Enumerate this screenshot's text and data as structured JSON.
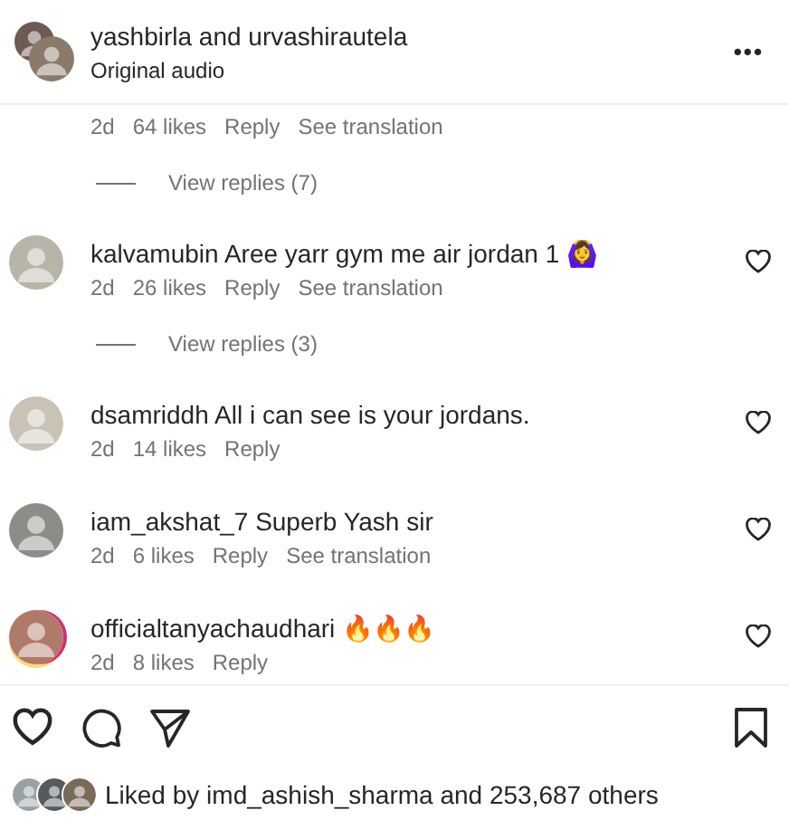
{
  "post": {
    "authors": "yashbirla and urvashirautela",
    "audio": "Original audio",
    "menu": "•••"
  },
  "comments": [
    {
      "time": "2d",
      "likes": "64 likes",
      "reply": "Reply",
      "translate": "See translation",
      "replies": "View replies (7)"
    },
    {
      "user": "kalvamubin",
      "text": "Aree yarr gym me air jordan 1 🙆‍♀️",
      "time": "2d",
      "likes": "26 likes",
      "reply": "Reply",
      "translate": "See translation",
      "replies": "View replies (3)",
      "liked": false
    },
    {
      "user": "dsamriddh",
      "text": "All i can see is your jordans.",
      "time": "2d",
      "likes": "14 likes",
      "reply": "Reply",
      "liked": false
    },
    {
      "user": "iam_akshat_7",
      "text": "Superb Yash sir",
      "time": "2d",
      "likes": "6 likes",
      "reply": "Reply",
      "translate": "See translation",
      "liked": false
    },
    {
      "user": "officialtanyachaudhari",
      "text": "🔥🔥🔥",
      "time": "2d",
      "likes": "8 likes",
      "reply": "Reply",
      "liked": false,
      "story": true
    }
  ],
  "actions": {
    "liked": false,
    "saved": false
  },
  "liked_by": {
    "prefix": "Liked by",
    "user": "imd_ashish_sharma",
    "suffix": "and 253,687 others"
  }
}
